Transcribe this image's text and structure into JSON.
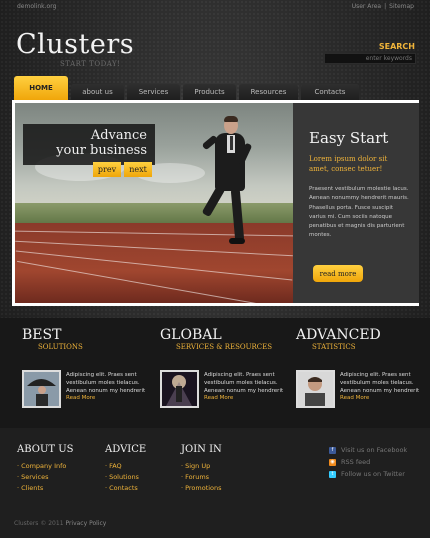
{
  "topbar": {
    "domain": "demolink.org",
    "links": [
      "User Area",
      "Sitemap"
    ],
    "separator": "|"
  },
  "header": {
    "logo": "Clusters",
    "tagline": "START TODAY!",
    "search_label": "SEARCH",
    "search_placeholder": "enter keywords"
  },
  "nav": {
    "items": [
      "HOME",
      "about us",
      "Services",
      "Products",
      "Resources",
      "Contacts"
    ],
    "active": "HOME"
  },
  "slider": {
    "caption_line1": "Advance",
    "caption_line2": "your business",
    "prev": "prev",
    "next": "next",
    "panel_title": "Easy Start",
    "panel_lead": "Lorem ipsum dolor sit amet, consec tetuer!",
    "panel_body": "Praesent vestibulum molestie lacus. Aenean nonummy hendrerit mauris. Phasellus porta. Fusce suscipit varius mi. Cum sociis natoque penatibus et magnis dis parturient montes.",
    "readmore": "read more"
  },
  "features": [
    {
      "title": "BEST",
      "subtitle": "SOLUTIONS",
      "text": "Adipiscing elit. Praes sent vestibulum moles tielacus. Aenean nonum my hendrerit",
      "more": "Read More"
    },
    {
      "title": "GLOBAL",
      "subtitle": "SERVICES & RESOURCES",
      "text": "Adipiscing elit. Praes sent vestibulum moles tielacus. Aenean nonum my hendrerit",
      "more": "Read More"
    },
    {
      "title": "ADVANCED",
      "subtitle": "STATISTICS",
      "text": "Adipiscing elit. Praes sent vestibulum moles tielacus. Aenean nonum my hendrerit",
      "more": "Read More"
    }
  ],
  "footer": {
    "about": {
      "title": "ABOUT US",
      "items": [
        "Company Info",
        "Services",
        "Clients"
      ]
    },
    "advice": {
      "title": "ADVICE",
      "items": [
        "FAQ",
        "Solutions",
        "Contacts"
      ]
    },
    "join": {
      "title": "JOIN IN",
      "items": [
        "Sign Up",
        "Forums",
        "Promotions"
      ]
    },
    "social": [
      {
        "label": "Visit us on Facebook",
        "icon": "facebook-icon",
        "color": "#3b5998"
      },
      {
        "label": "RSS feed",
        "icon": "rss-icon",
        "color": "#f08a1c"
      },
      {
        "label": "Follow us on Twitter",
        "icon": "twitter-icon",
        "color": "#33ccff"
      }
    ],
    "copyright": "Clusters © 2011",
    "privacy": "Privacy Policy"
  },
  "colors": {
    "accent": "#f0b43a",
    "background": "#262626"
  }
}
